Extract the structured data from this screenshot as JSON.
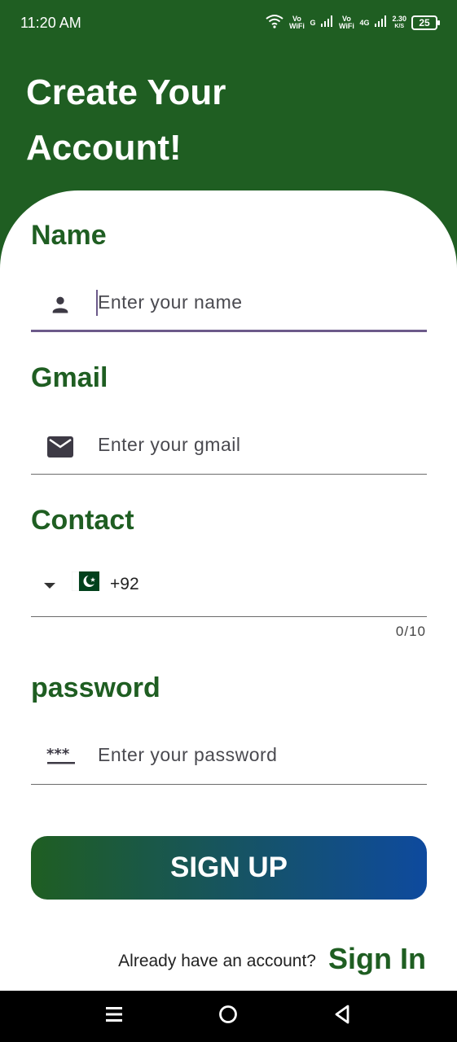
{
  "status_bar": {
    "time": "11:20 AM",
    "vo_wifi_1": "Vo WiFi",
    "network_1": "G",
    "vo_wifi_2": "Vo WiFi",
    "network_2": "4G",
    "speed_value": "2.30",
    "speed_unit": "K/S",
    "battery": "25"
  },
  "header": {
    "title": "Create Your Account!"
  },
  "form": {
    "name": {
      "label": "Name",
      "placeholder": "Enter your name",
      "icon": "person-icon"
    },
    "gmail": {
      "label": "Gmail",
      "placeholder": "Enter your gmail",
      "icon": "mail-icon"
    },
    "contact": {
      "label": "Contact",
      "country_code": "+92",
      "flag": "pakistan-flag",
      "counter": "0/10"
    },
    "password": {
      "label": "password",
      "placeholder": "Enter your password",
      "icon": "password-icon"
    }
  },
  "actions": {
    "signup_label": "SIGN UP"
  },
  "footer": {
    "prompt": "Already have an account?",
    "signin_label": "Sign In"
  },
  "colors": {
    "primary_green": "#1f5e22",
    "gradient_end": "#0e4a9e",
    "focus_underline": "#6c5a8a"
  }
}
